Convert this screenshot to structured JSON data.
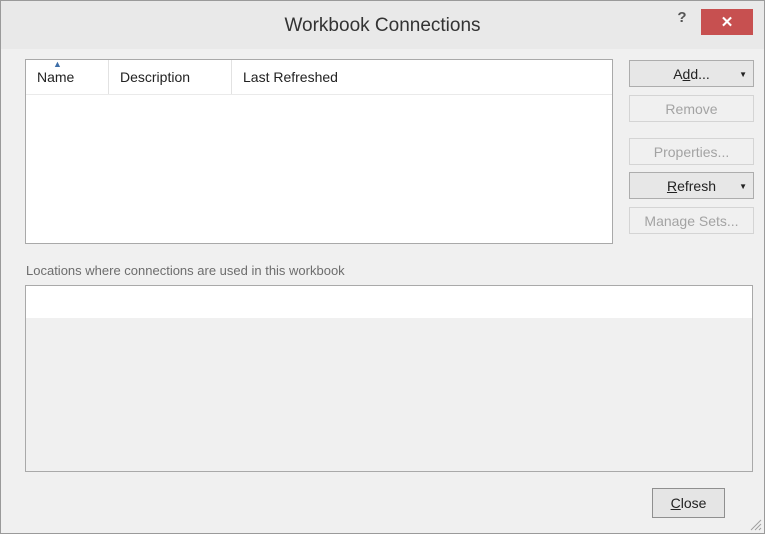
{
  "window": {
    "title": "Workbook Connections",
    "help_label": "?",
    "close_glyph": "✕"
  },
  "connections_table": {
    "columns": [
      {
        "label": "Name",
        "sorted": "ascending"
      },
      {
        "label": "Description"
      },
      {
        "label": "Last Refreshed"
      }
    ],
    "rows": []
  },
  "buttons": {
    "add": {
      "pre": "A",
      "key": "d",
      "post": "d...",
      "enabled": true,
      "dropdown": true
    },
    "remove": {
      "label": "Remove",
      "enabled": false
    },
    "properties": {
      "label": "Properties...",
      "enabled": false
    },
    "refresh": {
      "pre": "",
      "key": "R",
      "post": "efresh",
      "enabled": true,
      "dropdown": true
    },
    "manage_sets": {
      "label": "Manage Sets...",
      "enabled": false
    },
    "close": {
      "pre": "",
      "key": "C",
      "post": "lose",
      "enabled": true
    }
  },
  "locations": {
    "label": "Locations where connections are used in this workbook",
    "items": []
  },
  "icons": {
    "sort_ascending": "sort-ascending-icon",
    "dropdown": "chevron-down-icon",
    "resize": "resize-grip-icon"
  },
  "colors": {
    "close_button_bg": "#c75050",
    "sort_arrow": "#3d6ea8",
    "dialog_bg": "#f0f0f0"
  }
}
